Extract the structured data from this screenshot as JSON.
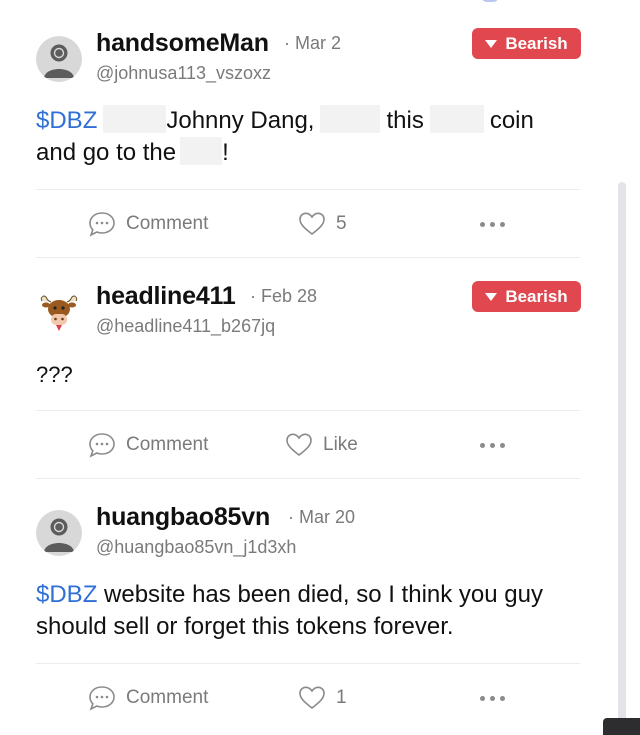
{
  "posts": [
    {
      "username": "handsomeMan",
      "date": "· Mar 2",
      "handle": "@johnusa113_vszoxz",
      "sentiment": "Bearish",
      "text": {
        "cashtag": "$DBZ",
        "part1": "Johnny Dang,",
        "part2": "this",
        "part3": "coin",
        "part4": "and go to the",
        "part5": "!"
      },
      "comment_label": "Comment",
      "like_label": "5",
      "avatar_icon": "default-user-avatar"
    },
    {
      "username": "headline411",
      "date": "· Feb 28",
      "handle": "@headline411_b267jq",
      "sentiment": "Bearish",
      "text": {
        "body": "???"
      },
      "comment_label": "Comment",
      "like_label": "Like",
      "avatar_icon": "bull-avatar"
    },
    {
      "username": "huangbao85vn",
      "date": "· Mar 20",
      "handle": "@huangbao85vn_j1d3xh",
      "text": {
        "cashtag": "$DBZ",
        "line1": "website has been died, so I think you guy",
        "line2": "should sell or forget this tokens forever."
      },
      "comment_label": "Comment",
      "like_label": "1",
      "avatar_icon": "default-user-avatar"
    }
  ],
  "colors": {
    "bearish_red": "#e0474e",
    "cashtag_blue": "#2f6fd6",
    "muted_gray": "#7a7a7a"
  },
  "icons": [
    "comment-icon",
    "heart-icon",
    "more-options-icon",
    "caret-down-icon"
  ]
}
